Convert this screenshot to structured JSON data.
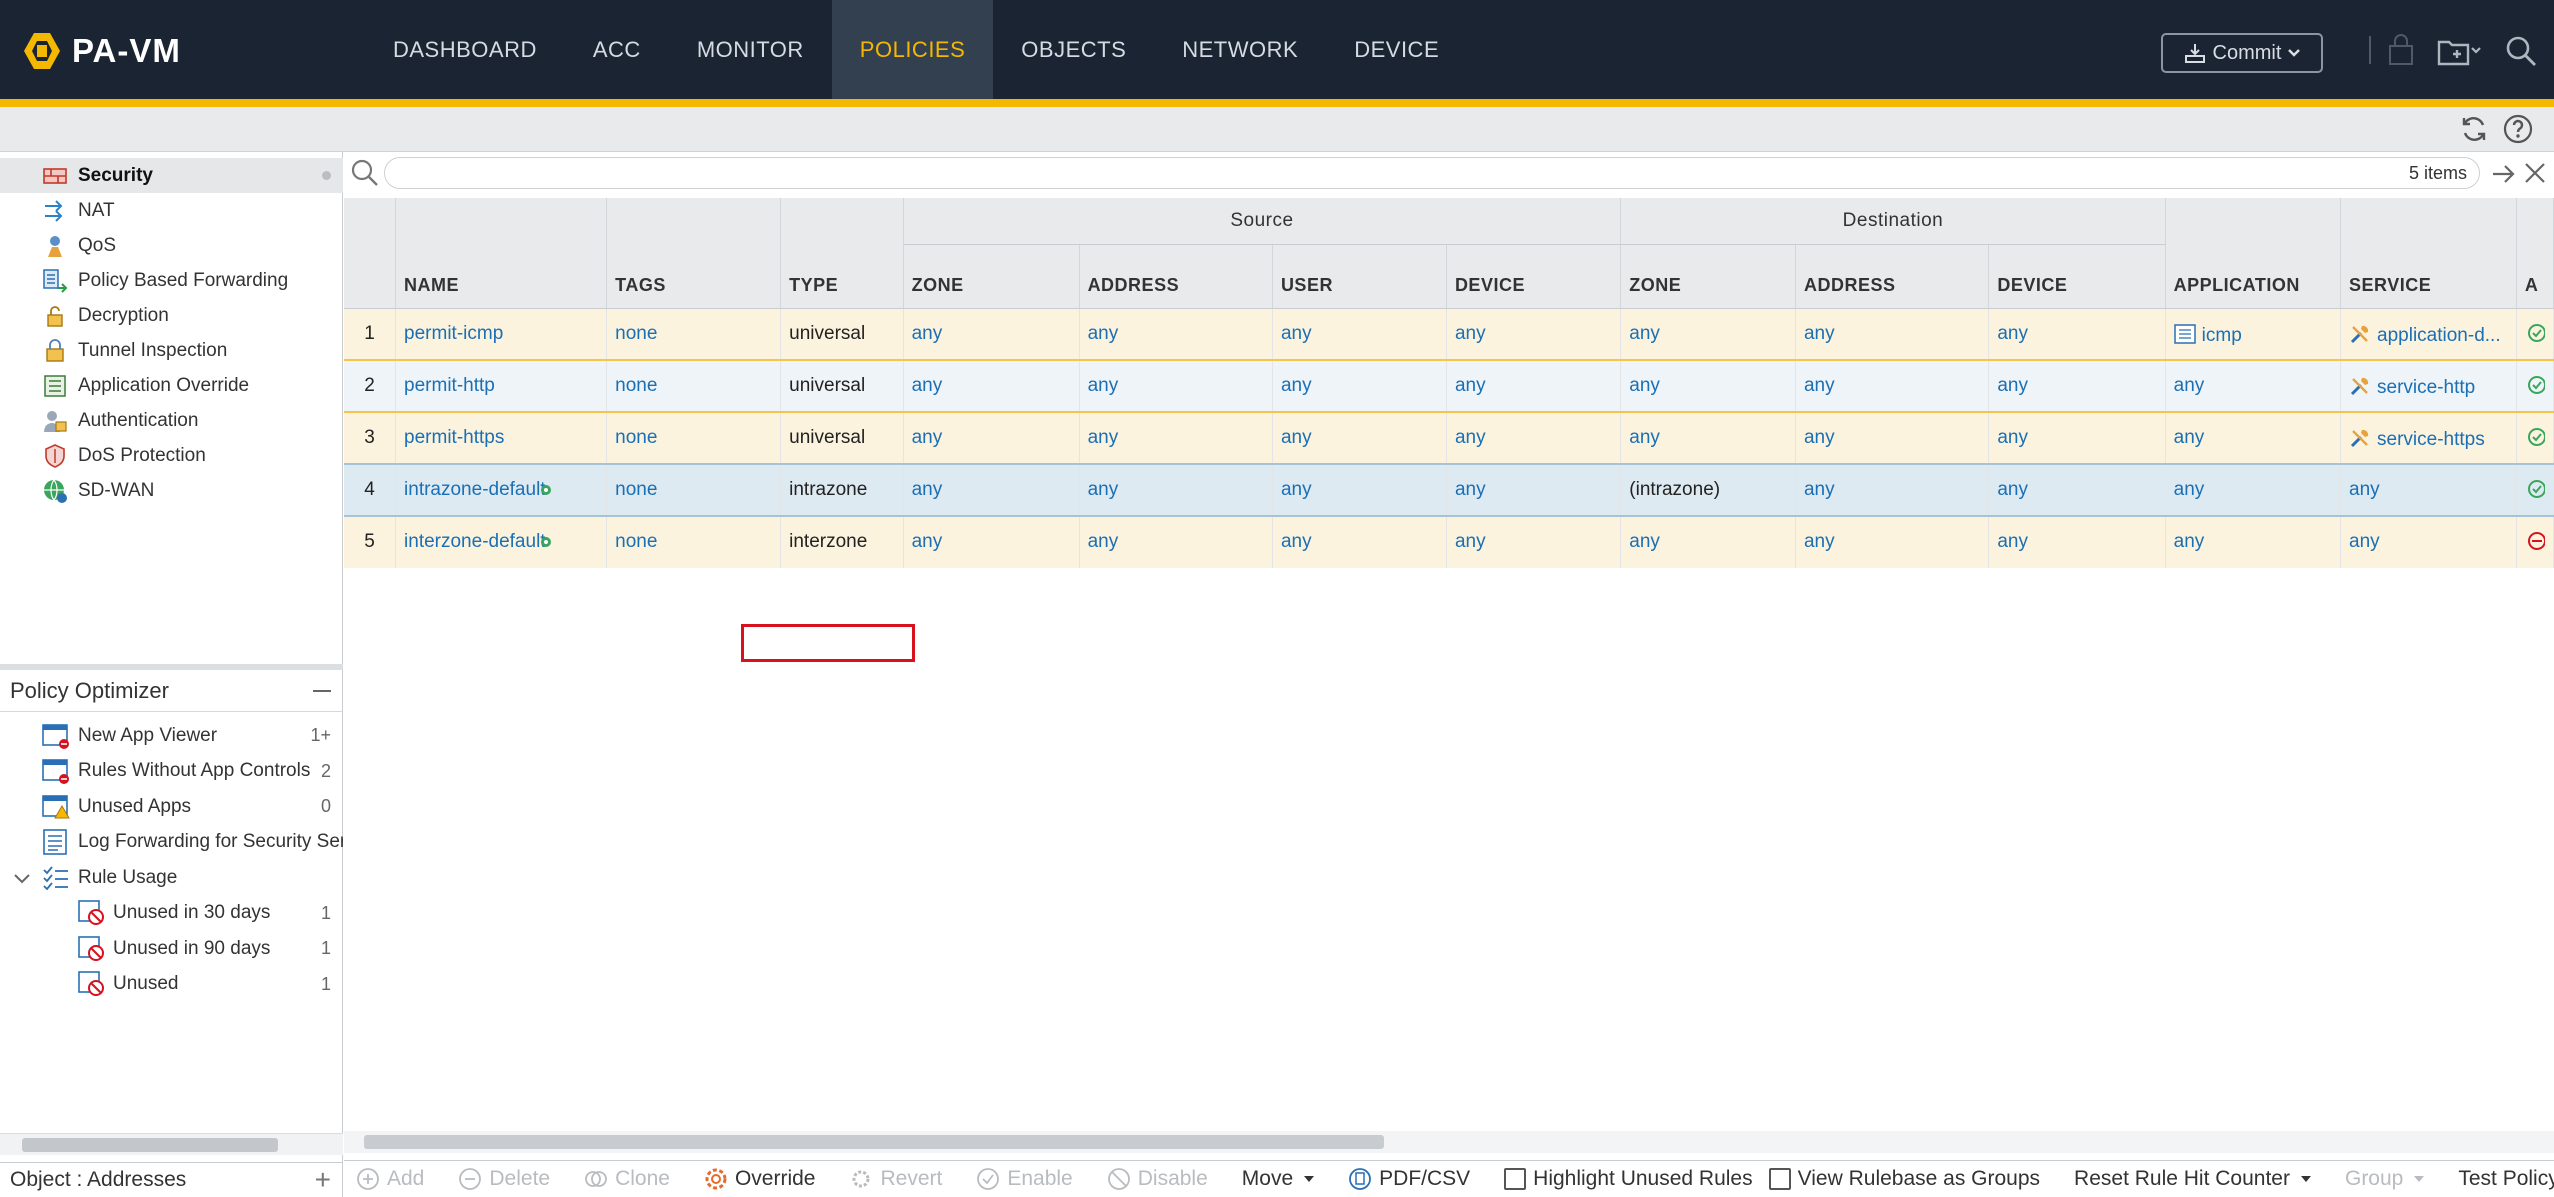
{
  "app": {
    "logo_text": "PA-VM"
  },
  "nav": {
    "items": [
      "DASHBOARD",
      "ACC",
      "MONITOR",
      "POLICIES",
      "OBJECTS",
      "NETWORK",
      "DEVICE"
    ],
    "active": "POLICIES",
    "commit_label": "Commit"
  },
  "sidebar": {
    "items": [
      {
        "label": "Security",
        "icon": "security-rule-icon",
        "active": true
      },
      {
        "label": "NAT",
        "icon": "nat-icon"
      },
      {
        "label": "QoS",
        "icon": "qos-icon"
      },
      {
        "label": "Policy Based Forwarding",
        "icon": "pbf-icon"
      },
      {
        "label": "Decryption",
        "icon": "lock-icon"
      },
      {
        "label": "Tunnel Inspection",
        "icon": "tunnel-lock-icon"
      },
      {
        "label": "Application Override",
        "icon": "app-override-icon"
      },
      {
        "label": "Authentication",
        "icon": "authentication-icon"
      },
      {
        "label": "DoS Protection",
        "icon": "dos-shield-icon"
      },
      {
        "label": "SD-WAN",
        "icon": "sdwan-globe-icon"
      }
    ]
  },
  "optimizer": {
    "title": "Policy Optimizer",
    "items": [
      {
        "label": "New App Viewer",
        "count": "1+",
        "icon": "window-alert-icon",
        "indent": 0
      },
      {
        "label": "Rules Without App Controls",
        "count": "2",
        "icon": "window-alert-icon",
        "indent": 0
      },
      {
        "label": "Unused Apps",
        "count": "0",
        "icon": "window-warning-icon",
        "indent": 0
      },
      {
        "label": "Log Forwarding for Security Services",
        "count": "",
        "icon": "log-list-icon",
        "indent": 0
      },
      {
        "label": "Rule Usage",
        "count": "",
        "icon": "checklist-icon",
        "indent": 0,
        "expander": true
      },
      {
        "label": "Unused in 30 days",
        "count": "1",
        "icon": "no-entry-icon",
        "indent": 1
      },
      {
        "label": "Unused in 90 days",
        "count": "1",
        "icon": "no-entry-icon",
        "indent": 1
      },
      {
        "label": "Unused",
        "count": "1",
        "icon": "no-entry-icon",
        "indent": 1
      }
    ]
  },
  "object_panel": {
    "label": "Object : Addresses"
  },
  "search": {
    "placeholder": "",
    "items_count": "5 items"
  },
  "table": {
    "group_headers": {
      "source": "Source",
      "destination": "Destination"
    },
    "columns": [
      "NAME",
      "TAGS",
      "TYPE",
      "ZONE",
      "ADDRESS",
      "USER",
      "DEVICE",
      "ZONE",
      "ADDRESS",
      "DEVICE",
      "APPLICATION",
      "SERVICE",
      "A"
    ],
    "rows": [
      {
        "num": "1",
        "name": "permit-icmp",
        "tags": "none",
        "type": "universal",
        "src_zone": "any",
        "src_address": "any",
        "src_user": "any",
        "src_device": "any",
        "dst_zone": "any",
        "dst_address": "any",
        "dst_device": "any",
        "application": "icmp",
        "service": "application-d..."
      },
      {
        "num": "2",
        "name": "permit-http",
        "tags": "none",
        "type": "universal",
        "src_zone": "any",
        "src_address": "any",
        "src_user": "any",
        "src_device": "any",
        "dst_zone": "any",
        "dst_address": "any",
        "dst_device": "any",
        "application": "any",
        "service": "service-http"
      },
      {
        "num": "3",
        "name": "permit-https",
        "tags": "none",
        "type": "universal",
        "src_zone": "any",
        "src_address": "any",
        "src_user": "any",
        "src_device": "any",
        "dst_zone": "any",
        "dst_address": "any",
        "dst_device": "any",
        "application": "any",
        "service": "service-https"
      },
      {
        "num": "4",
        "name": "intrazone-default",
        "tags": "none",
        "type": "intrazone",
        "src_zone": "any",
        "src_address": "any",
        "src_user": "any",
        "src_device": "any",
        "dst_zone": "(intrazone)",
        "dst_address": "any",
        "dst_device": "any",
        "application": "any",
        "service": "any"
      },
      {
        "num": "5",
        "name": "interzone-default",
        "tags": "none",
        "type": "interzone",
        "src_zone": "any",
        "src_address": "any",
        "src_user": "any",
        "src_device": "any",
        "dst_zone": "any",
        "dst_address": "any",
        "dst_device": "any",
        "application": "any",
        "service": "any"
      }
    ]
  },
  "toolbar": {
    "add": "Add",
    "delete": "Delete",
    "clone": "Clone",
    "override": "Override",
    "revert": "Revert",
    "enable": "Enable",
    "disable": "Disable",
    "move": "Move",
    "pdf_csv": "PDF/CSV",
    "highlight_unused": "Highlight Unused Rules",
    "view_groups": "View Rulebase as Groups",
    "reset_counter": "Reset Rule Hit Counter",
    "group": "Group",
    "test_policy": "Test Policy Match"
  },
  "colors": {
    "nav_bg": "#1b2432",
    "accent": "#f5b800",
    "link": "#1a6fb5",
    "highlight": "#d7121e"
  }
}
